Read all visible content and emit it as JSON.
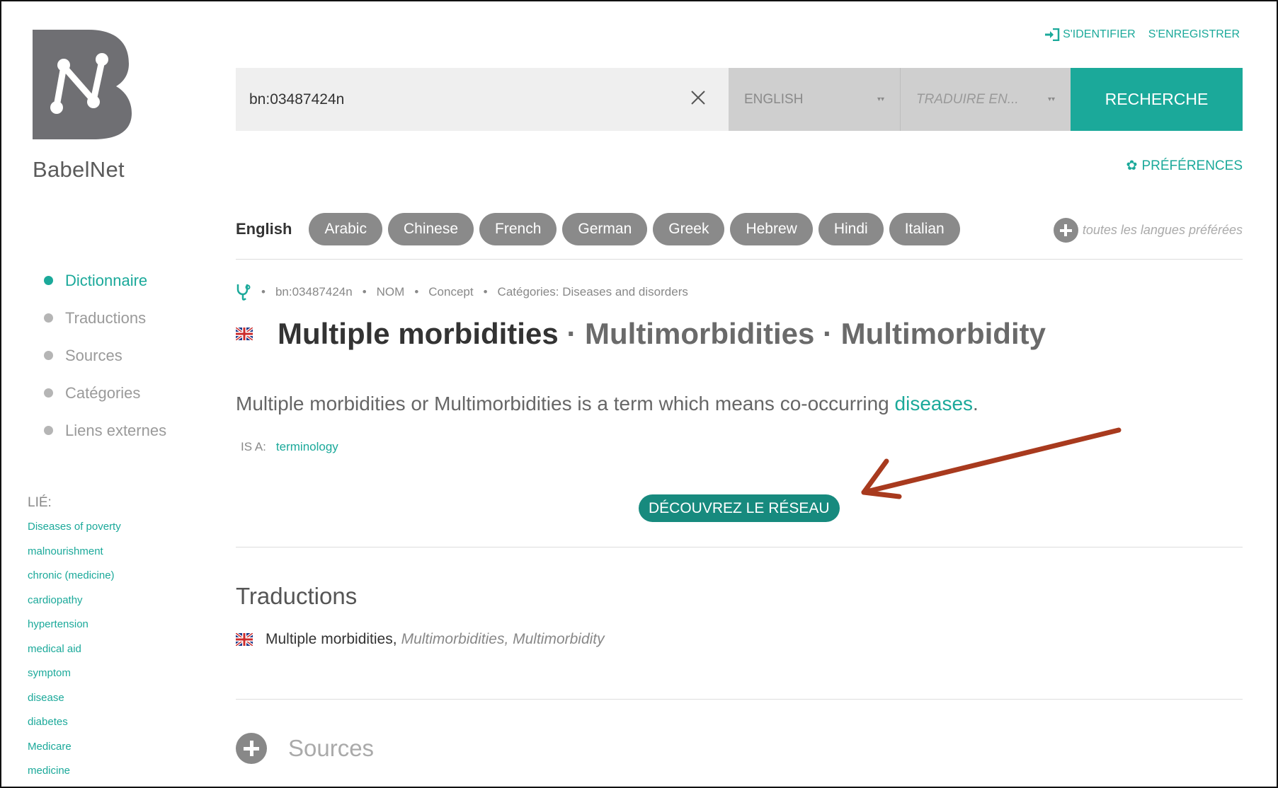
{
  "brand": {
    "name": "BabelNet"
  },
  "auth": {
    "login": "S'IDENTIFIER",
    "register": "S'ENREGISTRER"
  },
  "search": {
    "query": "bn:03487424n",
    "source_lang": "ENGLISH",
    "target_lang_placeholder": "TRADUIRE EN...",
    "button": "RECHERCHE"
  },
  "preferences": "PRÉFÉRENCES",
  "languages": {
    "current": "English",
    "chips": [
      "Arabic",
      "Chinese",
      "French",
      "German",
      "Greek",
      "Hebrew",
      "Hindi",
      "Italian"
    ],
    "all_label": "toutes les langues préférées"
  },
  "sidebar": {
    "nav": [
      {
        "label": "Dictionnaire",
        "active": true
      },
      {
        "label": "Traductions",
        "active": false
      },
      {
        "label": "Sources",
        "active": false
      },
      {
        "label": "Catégories",
        "active": false
      },
      {
        "label": "Liens externes",
        "active": false
      }
    ],
    "related_title": "LIÉ:",
    "related": [
      "Diseases of poverty",
      "malnourishment",
      "chronic (medicine)",
      "cardiopathy",
      "hypertension",
      "medical aid",
      "symptom",
      "disease",
      "diabetes",
      "Medicare",
      "medicine"
    ]
  },
  "synset": {
    "id": "bn:03487424n",
    "pos": "NOM",
    "type": "Concept",
    "categories": "Catégories: Diseases and disorders",
    "title_main": "Multiple morbidities",
    "title_alt": " · Multimorbidities · Multimorbidity",
    "gloss_text": "Multiple morbidities or Multimorbidities is a term which means co-occurring ",
    "gloss_link": "diseases",
    "gloss_end": ".",
    "isa_label": "IS A:",
    "isa_value": "terminology",
    "discover": "DÉCOUVREZ LE RÉSEAU"
  },
  "translations": {
    "title": "Traductions",
    "main": "Multiple morbidities,",
    "others": "Multimorbidities, Multimorbidity"
  },
  "sources": {
    "title": "Sources"
  },
  "colors": {
    "accent": "#1ba99a",
    "arrow": "#a83a1e",
    "logo": "#6f6f73"
  }
}
